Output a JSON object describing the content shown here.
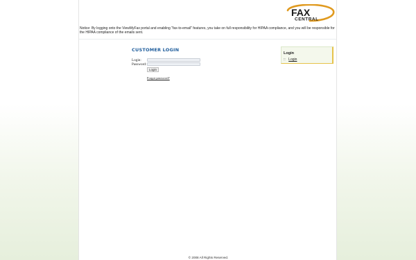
{
  "header": {
    "logo_line1": "FAX",
    "logo_line2": "CENTRAL",
    "accent_color": "#e09a1f",
    "logo_color": "#1a1a1a"
  },
  "notice": "Notice: By logging onto the ViewMyFax portal and enabling \"fax-to-email\" features, you take on full responsibility for HIPAA compliance, and you will be responsible for the HIPAA compliance of the emails sent.",
  "login": {
    "title": "CUSTOMER LOGIN",
    "login_label": "Login:",
    "login_value": "",
    "password_label": "Password:",
    "password_value": "",
    "submit_label": "Login",
    "forgot_label": "Forgot password?"
  },
  "sidebar": {
    "title": "Login",
    "bullet": "::",
    "item_label": "Login"
  },
  "footer": {
    "copyright": "© 2008 All Rights Reserved."
  }
}
